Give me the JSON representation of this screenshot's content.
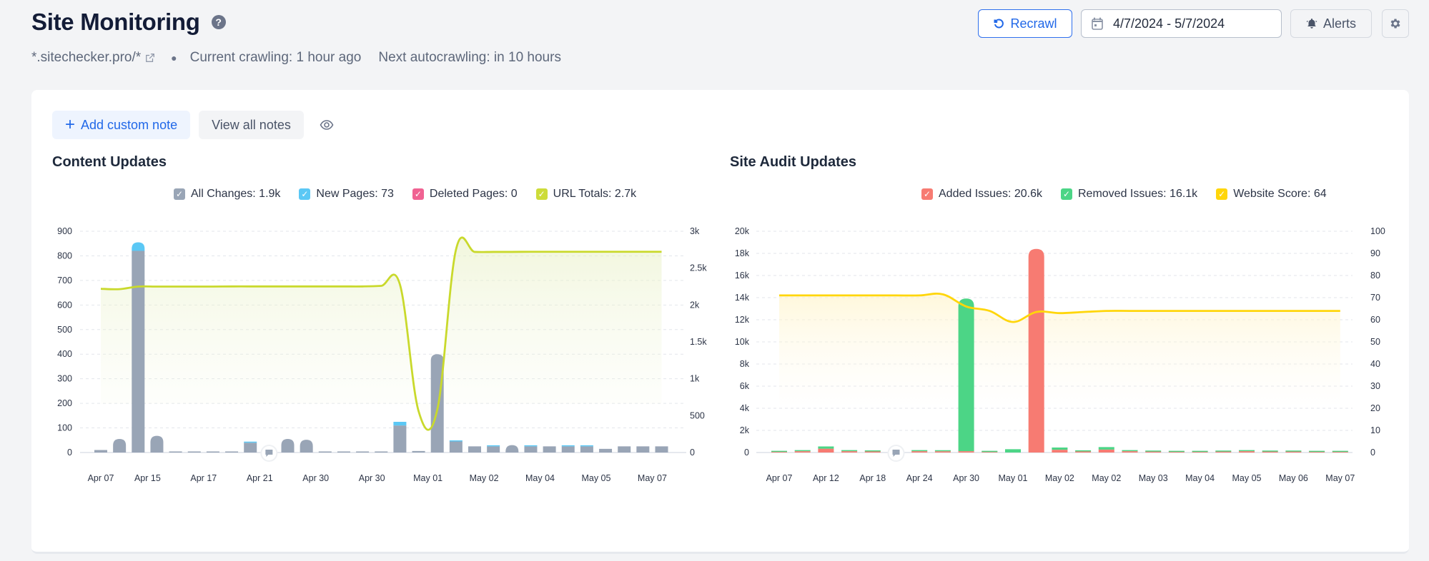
{
  "header": {
    "title": "Site Monitoring",
    "help_icon": "question-circle-icon",
    "domain": "*.sitechecker.pro/*",
    "current_crawling": "Current crawling: 1 hour ago",
    "next_autocrawling": "Next autocrawling: in 10 hours"
  },
  "toolbar": {
    "recrawl_label": "Recrawl",
    "date_range": "4/7/2024 - 5/7/2024",
    "alerts_label": "Alerts"
  },
  "notes": {
    "add_label": "Add custom note",
    "view_label": "View all notes"
  },
  "colors": {
    "accent": "#2168e8",
    "all_changes": "#99a5b6",
    "new_pages": "#5bc8f5",
    "deleted_pages": "#f06292",
    "url_totals": "#cddc39",
    "added_issues": "#f77b72",
    "removed_issues": "#4cd586",
    "website_score": "#ffd60a"
  },
  "chart_data": [
    {
      "type": "bar",
      "title": "Content Updates",
      "legend": [
        {
          "key": "all_changes",
          "label": "All Changes: 1.9k"
        },
        {
          "key": "new_pages",
          "label": "New Pages: 73"
        },
        {
          "key": "deleted_pages",
          "label": "Deleted Pages: 0"
        },
        {
          "key": "url_totals",
          "label": "URL Totals: 2.7k"
        }
      ],
      "legend_position": "top-right",
      "y_left": {
        "ticks": [
          "0",
          "100",
          "200",
          "300",
          "400",
          "500",
          "600",
          "700",
          "800",
          "900"
        ],
        "range": [
          0,
          900
        ]
      },
      "y_right": {
        "ticks": [
          "0",
          "500",
          "1k",
          "1.5k",
          "2k",
          "2.5k",
          "3k"
        ],
        "range": [
          0,
          3000
        ]
      },
      "x_tick_labels": [
        "Apr 07",
        "Apr 15",
        "Apr 17",
        "Apr 21",
        "Apr 30",
        "Apr 30",
        "May 01",
        "May 02",
        "May 04",
        "May 05",
        "May 07"
      ],
      "x_tick_indices": [
        0,
        2.5,
        5.5,
        8.5,
        11.5,
        14.5,
        17.5,
        20.5,
        23.5,
        26.5,
        29.5
      ],
      "grid": true,
      "series": [
        {
          "name": "All Changes",
          "values": [
            10,
            55,
            820,
            68,
            2,
            2,
            2,
            2,
            40,
            30,
            55,
            52,
            2,
            2,
            2,
            2,
            110,
            6,
            400,
            45,
            25,
            25,
            30,
            25,
            25,
            25,
            25,
            15,
            25,
            25,
            25
          ]
        },
        {
          "name": "New Pages",
          "values": [
            0,
            0,
            35,
            0,
            0,
            0,
            0,
            0,
            4,
            0,
            0,
            0,
            0,
            0,
            0,
            0,
            15,
            0,
            0,
            2,
            0,
            3,
            0,
            2,
            0,
            2,
            2,
            0,
            0,
            0,
            0
          ]
        },
        {
          "name": "URL Totals",
          "axis": "right",
          "values": [
            2220,
            2215,
            2250,
            2250,
            2250,
            2250,
            2250,
            2252,
            2252,
            2252,
            2252,
            2252,
            2252,
            2252,
            2252,
            2260,
            2280,
            560,
            580,
            2750,
            2720,
            2720,
            2720,
            2722,
            2722,
            2722,
            2722,
            2722,
            2722,
            2722,
            2722
          ]
        }
      ],
      "annotation": "note-marker at Apr 21"
    },
    {
      "type": "bar",
      "title": "Site Audit Updates",
      "legend": [
        {
          "key": "added_issues",
          "label": "Added Issues: 20.6k"
        },
        {
          "key": "removed_issues",
          "label": "Removed Issues: 16.1k"
        },
        {
          "key": "website_score",
          "label": "Website Score: 64"
        }
      ],
      "legend_position": "top-right",
      "y_left": {
        "ticks": [
          "0",
          "2k",
          "4k",
          "6k",
          "8k",
          "10k",
          "12k",
          "14k",
          "16k",
          "18k",
          "20k"
        ],
        "range": [
          0,
          20000
        ]
      },
      "y_right": {
        "ticks": [
          "0",
          "10",
          "20",
          "30",
          "40",
          "50",
          "60",
          "70",
          "80",
          "90",
          "100"
        ],
        "range": [
          0,
          100
        ]
      },
      "x_tick_labels": [
        "Apr 07",
        "Apr 12",
        "Apr 18",
        "Apr 24",
        "Apr 30",
        "May 01",
        "May 02",
        "May 02",
        "May 03",
        "May 04",
        "May 05",
        "May 06",
        "May 07"
      ],
      "x_tick_indices": [
        0,
        2,
        4,
        6,
        8,
        10,
        12,
        14,
        16,
        18,
        20,
        22,
        24
      ],
      "grid": true,
      "series": [
        {
          "name": "Added Issues",
          "values": [
            60,
            120,
            350,
            120,
            100,
            0,
            120,
            110,
            120,
            50,
            0,
            18400,
            250,
            100,
            270,
            120,
            80,
            60,
            60,
            80,
            120,
            80,
            80,
            60,
            60
          ]
        },
        {
          "name": "Removed Issues",
          "values": [
            80,
            60,
            200,
            100,
            80,
            0,
            80,
            80,
            13800,
            100,
            300,
            0,
            200,
            100,
            220,
            80,
            60,
            60,
            60,
            20,
            60,
            100,
            60,
            50,
            20
          ]
        },
        {
          "name": "Website Score",
          "axis": "right",
          "values": [
            71,
            71,
            71,
            71,
            71,
            71,
            71,
            71.5,
            66,
            64,
            59,
            63.5,
            63,
            63.5,
            64,
            64,
            64,
            64,
            64,
            64,
            64,
            64,
            64,
            64,
            64
          ]
        }
      ],
      "annotation": "note-marker between Apr 18 and Apr 24"
    }
  ]
}
